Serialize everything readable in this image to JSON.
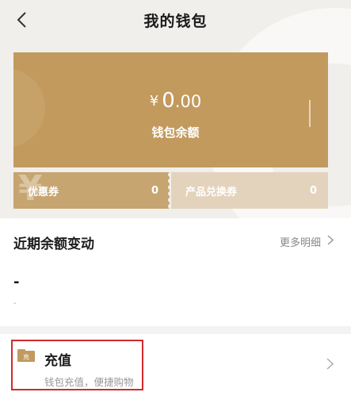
{
  "nav": {
    "title": "我的钱包"
  },
  "wallet": {
    "currency_symbol": "¥",
    "amount_int": "0",
    "amount_dec": ".00",
    "balance_label": "钱包余额"
  },
  "coupons": {
    "coupon_label": "优惠券",
    "coupon_count": "0",
    "exchange_label": "产品兑换券",
    "exchange_count": "0",
    "watermark": "¥"
  },
  "recent": {
    "title": "近期余额变动",
    "more_label": "更多明细",
    "placeholder_value": "-",
    "placeholder_sub": "-"
  },
  "recharge": {
    "icon_text": "充",
    "title": "充值",
    "subtitle": "钱包充值，便捷购物"
  },
  "colors": {
    "card": "#c29a5d",
    "coupon_left": "#c6a570",
    "coupon_right": "#e3d3bd",
    "highlight_border": "#d02b2b"
  }
}
